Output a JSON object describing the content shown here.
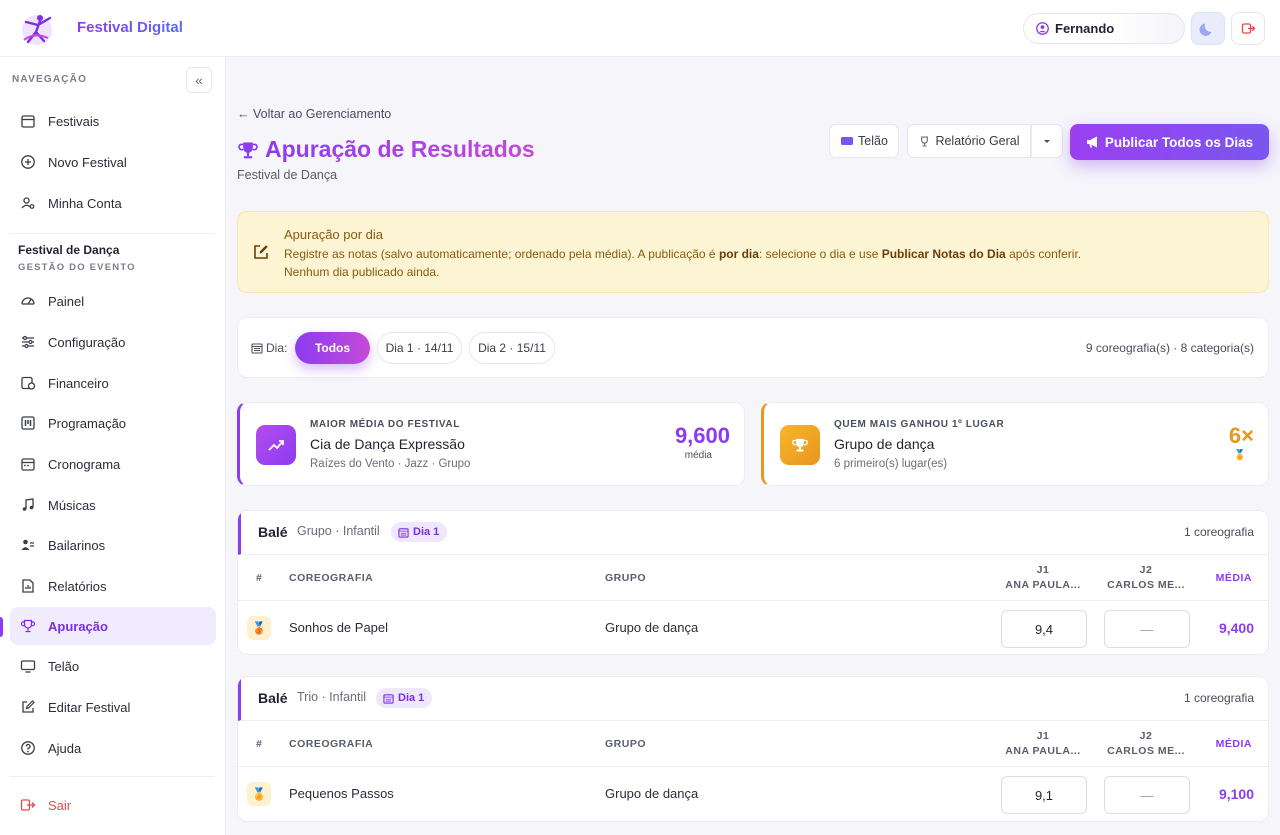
{
  "app": {
    "brand": "Festival Digital"
  },
  "header": {
    "user_name": "Fernando"
  },
  "sidebar": {
    "nav_heading": "NAVEGAÇÃO",
    "top_items": [
      {
        "label": "Festivais",
        "icon": "calendar-icon"
      },
      {
        "label": "Novo Festival",
        "icon": "plus-circle-icon"
      },
      {
        "label": "Minha Conta",
        "icon": "user-settings-icon"
      }
    ],
    "event_title": "Festival de Dança",
    "event_sub": "GESTÃO DO EVENTO",
    "event_items": [
      {
        "label": "Painel",
        "icon": "dashboard-icon"
      },
      {
        "label": "Configuração",
        "icon": "sliders-icon"
      },
      {
        "label": "Financeiro",
        "icon": "finance-icon"
      },
      {
        "label": "Programação",
        "icon": "program-icon"
      },
      {
        "label": "Cronograma",
        "icon": "schedule-icon"
      },
      {
        "label": "Músicas",
        "icon": "music-icon"
      },
      {
        "label": "Bailarinos",
        "icon": "dancers-icon"
      },
      {
        "label": "Relatórios",
        "icon": "report-icon"
      },
      {
        "label": "Apuração",
        "icon": "trophy-icon"
      },
      {
        "label": "Telão",
        "icon": "monitor-icon"
      },
      {
        "label": "Editar Festival",
        "icon": "edit-icon"
      },
      {
        "label": "Ajuda",
        "icon": "help-icon"
      }
    ],
    "exit_label": "Sair"
  },
  "page": {
    "back": "← Voltar ao Gerenciamento",
    "title": "Apuração de Resultados",
    "subtitle": "Festival de Dança",
    "btn_telao": "Telão",
    "btn_relatorio": "Relatório Geral",
    "btn_publish": "Publicar Todos os Dias"
  },
  "notice": {
    "title": "Apuração por dia",
    "line1_a": "Registre as notas (salvo automaticamente; ordenado pela média). A publicação é ",
    "line1_b": "por dia",
    "line1_c": ": selecione o dia e use ",
    "line1_d": "Publicar Notas do Dia",
    "line1_e": " após conferir.",
    "line2": "Nenhum dia publicado ainda."
  },
  "days": {
    "label": "Dia:",
    "options": [
      "Todos",
      "Dia 1 · 14/11",
      "Dia 2 · 15/11"
    ],
    "selected": "Todos",
    "summary": "9 coreografia(s) · 8 categoria(s)"
  },
  "stats": [
    {
      "key": "MAIOR MÉDIA DO FESTIVAL",
      "value": "Cia de Dança Expressão",
      "detail": "Raízes do Vento · Jazz · Grupo",
      "big": "9,600",
      "unit": "média"
    },
    {
      "key": "QUEM MAIS GANHOU 1º LUGAR",
      "value": "Grupo de dança",
      "detail": "6 primeiro(s) lugar(es)",
      "big": "6×"
    }
  ],
  "table_headers": {
    "num": "#",
    "coreografia": "COREOGRAFIA",
    "grupo": "GRUPO",
    "j1a": "J1",
    "j1b": "ANA PAULA...",
    "j2a": "J2",
    "j2b": "CARLOS ME...",
    "media": "MÉDIA"
  },
  "categories": [
    {
      "name": "Balé",
      "desc": "Grupo · Infantil",
      "badge": "Dia 1",
      "count": "1 coreografia",
      "row": {
        "coreografia": "Sonhos de Papel",
        "grupo": "Grupo de dança",
        "j1": "9,4",
        "j2": "—",
        "media": "9,400"
      }
    },
    {
      "name": "Balé",
      "desc": "Trio · Infantil",
      "badge": "Dia 1",
      "count": "1 coreografia",
      "row": {
        "coreografia": "Pequenos Passos",
        "grupo": "Grupo de dança",
        "j1": "9,1",
        "j2": "—",
        "media": "9,100"
      }
    }
  ]
}
